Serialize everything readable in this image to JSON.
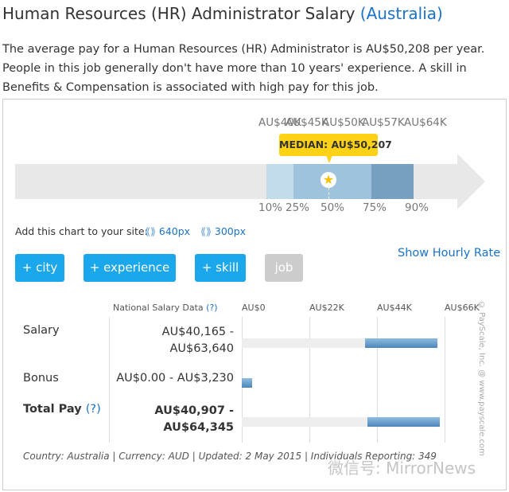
{
  "title": {
    "main": "Human Resources (HR) Administrator Salary",
    "country": "(Australia)"
  },
  "description": "The average pay for a Human Resources (HR) Administrator is AU$50,208 per year. People in this job generally don't have more than 10 years' experience. A skill in Benefits & Compensation is associated with high pay for this job.",
  "chart": {
    "top_labels": [
      "AU$40K",
      "AU$45K",
      "AU$50K",
      "AU$57K",
      "AU$64K"
    ],
    "percentiles": [
      "10%",
      "25%",
      "50%",
      "75%",
      "90%"
    ],
    "median_label": "MEDIAN: AU$50,207",
    "colors": {
      "p10_25": "#c2dcec",
      "p25_75": "#9fc3dc",
      "p75_90": "#779fc0",
      "median": "#ffd215"
    }
  },
  "embed": {
    "label": "Add this chart to your site:",
    "opt1": "640px",
    "opt2": "300px"
  },
  "buttons": {
    "city": "+ city",
    "experience": "+ experience",
    "skill": "+ skill",
    "job": "job"
  },
  "hourly_link": "Show Hourly Rate",
  "table": {
    "header": "National Salary Data",
    "help": "(?)",
    "axis": [
      "AU$0",
      "AU$22K",
      "AU$44K",
      "AU$66K"
    ],
    "rows": [
      {
        "label": "Salary",
        "range1": "AU$40,165 -",
        "range2": "AU$63,640",
        "low": 40165,
        "high": 63640
      },
      {
        "label": "Bonus",
        "range1": "AU$0.00 - AU$3,230",
        "low": 0,
        "high": 3230
      },
      {
        "label": "Total Pay",
        "help": "(?)",
        "range1": "AU$40,907 -",
        "range2": "AU$64,345",
        "low": 40907,
        "high": 64345
      }
    ],
    "axis_max": 66000
  },
  "copyright": "© PayScale, Inc. @ www.payscale.com",
  "footer": "Country: Australia | Currency: AUD | Updated: 2 May 2015 | Individuals Reporting: 349",
  "watermark": "微信号: MirrorNews"
}
